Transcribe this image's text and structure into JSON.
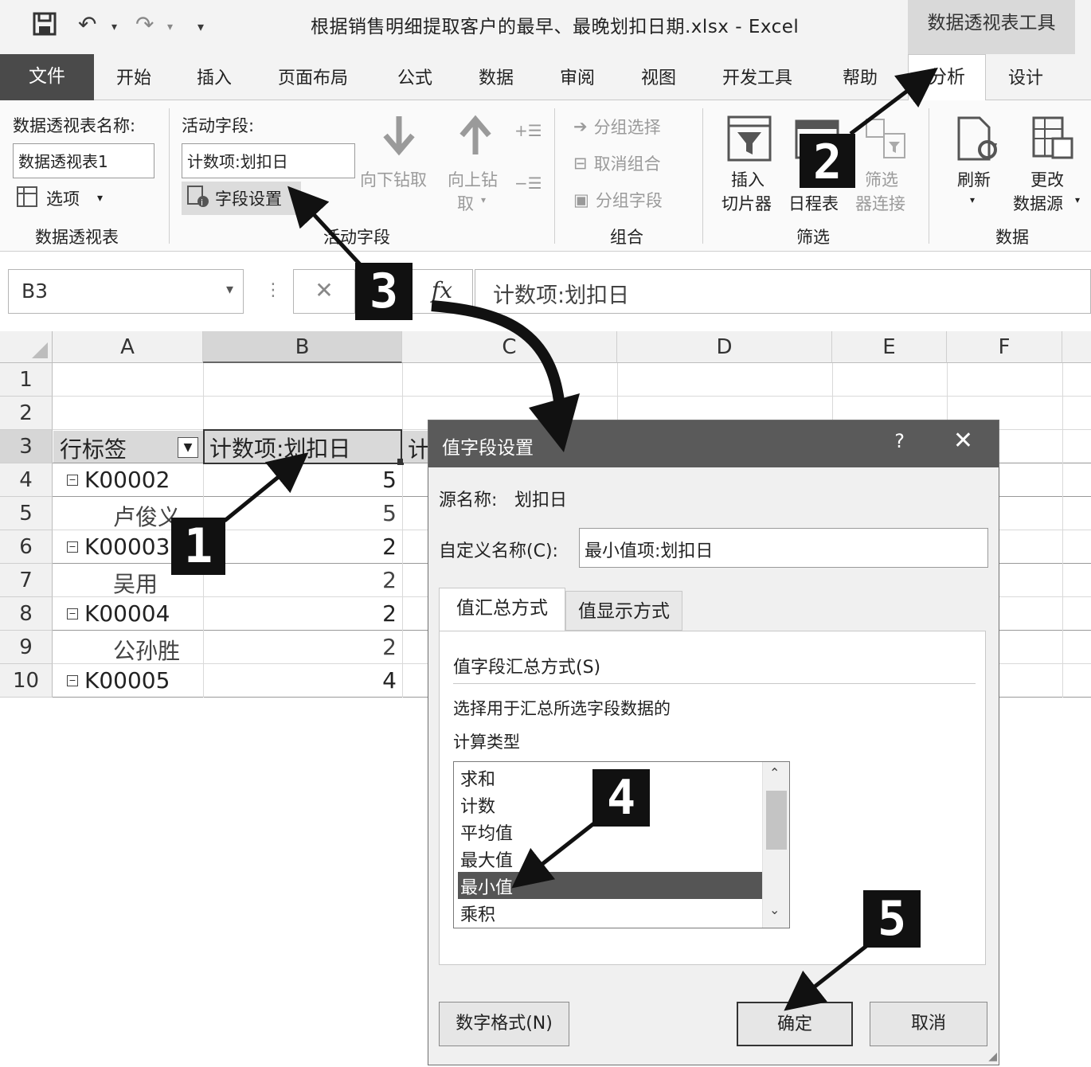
{
  "window": {
    "title": "根据销售明细提取客户的最早、最晚划扣日期.xlsx  -  Excel",
    "context_group": "数据透视表工具",
    "quick_access": {
      "save": "💾",
      "undo": "↶",
      "redo": "↷",
      "more": "▾"
    }
  },
  "ribbon": {
    "tabs": [
      "文件",
      "开始",
      "插入",
      "页面布局",
      "公式",
      "数据",
      "审阅",
      "视图",
      "开发工具",
      "帮助",
      "分析",
      "设计"
    ],
    "active_tab": "分析",
    "pivot_group": {
      "name_label": "数据透视表名称:",
      "name_value": "数据透视表1",
      "options_label": "选项",
      "group_name": "数据透视表"
    },
    "active_field_group": {
      "label": "活动字段:",
      "value": "计数项:划扣日",
      "field_settings": "字段设置",
      "drill_down": "向下钻取",
      "drill_up_1": "向上钻",
      "drill_up_2": "取",
      "group_name": "活动字段"
    },
    "group_group": {
      "group_selection": "分组选择",
      "ungroup": "取消组合",
      "group_field": "分组字段",
      "group_name": "组合"
    },
    "filter_group": {
      "slicer_1": "插入",
      "slicer_2": "切片器",
      "timeline": "日程表",
      "filter_conn_1": "筛选",
      "filter_conn_2": "器连接",
      "group_name": "筛选"
    },
    "data_group": {
      "refresh": "刷新",
      "change_1": "更改",
      "change_2": "数据源",
      "group_name": "数据"
    }
  },
  "formula_bar": {
    "name_box": "B3",
    "cancel": "✕",
    "fx": "fx",
    "content": "计数项:划扣日"
  },
  "sheet": {
    "columns": [
      "A",
      "B",
      "C",
      "D",
      "E",
      "F"
    ],
    "rows": [
      "1",
      "2",
      "3",
      "4",
      "5",
      "6",
      "7",
      "8",
      "9",
      "10"
    ],
    "header_a": "行标签",
    "header_b": "计数项:划扣日",
    "header_c_partial": "计",
    "data": [
      {
        "label": "K00002",
        "value": "5",
        "level": 0
      },
      {
        "label": "卢俊义",
        "value": "5",
        "level": 1
      },
      {
        "label": "K00003",
        "value": "2",
        "level": 0
      },
      {
        "label": "吴用",
        "value": "2",
        "level": 1
      },
      {
        "label": "K00004",
        "value": "2",
        "level": 0
      },
      {
        "label": "公孙胜",
        "value": "2",
        "level": 1
      },
      {
        "label": "K00005",
        "value": "4",
        "level": 0
      }
    ]
  },
  "dialog": {
    "title": "值字段设置",
    "help": "?",
    "close": "✕",
    "source_label": "源名称:",
    "source_value": "划扣日",
    "custom_name_label": "自定义名称(C):",
    "custom_name_value": "最小值项:划扣日",
    "tabs": [
      "值汇总方式",
      "值显示方式"
    ],
    "section_title": "值字段汇总方式(S)",
    "desc_1": "选择用于汇总所选字段数据的",
    "desc_2": "计算类型",
    "list_items": [
      "求和",
      "计数",
      "平均值",
      "最大值",
      "最小值",
      "乘积"
    ],
    "selected_item": "最小值",
    "number_format": "数字格式(N)",
    "ok": "确定",
    "cancel": "取消"
  },
  "markers": [
    "1",
    "2",
    "3",
    "4",
    "5"
  ]
}
